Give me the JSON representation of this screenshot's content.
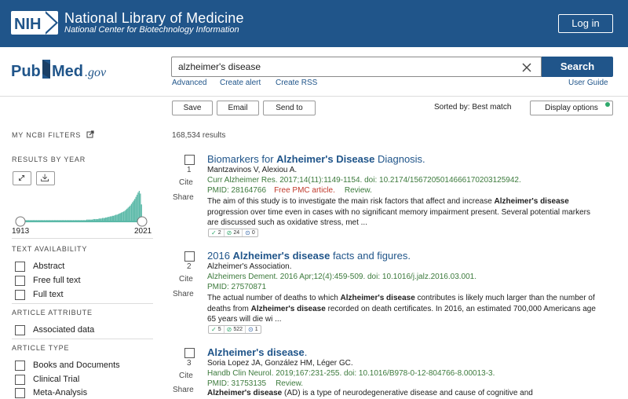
{
  "nih": {
    "logo_text": "NIH",
    "title": "National Library of Medicine",
    "subtitle": "National Center for Biotechnology Information",
    "login": "Log in"
  },
  "search": {
    "logo": "PubMed.gov",
    "query": "alzheimer's disease",
    "button": "Search",
    "links": [
      "Advanced",
      "Create alert",
      "Create RSS"
    ],
    "user_guide": "User Guide"
  },
  "toolbar": {
    "save": "Save",
    "email": "Email",
    "send_to": "Send to",
    "sorted_by": "Sorted by: Best match",
    "display_options": "Display options"
  },
  "sidebar": {
    "filters_head": "MY NCBI FILTERS",
    "by_year_head": "RESULTS BY YEAR",
    "year_start": "1913",
    "year_end": "2021",
    "text_availability_head": "TEXT AVAILABILITY",
    "text_availability": [
      "Abstract",
      "Free full text",
      "Full text"
    ],
    "article_attribute_head": "ARTICLE ATTRIBUTE",
    "article_attribute": [
      "Associated data"
    ],
    "article_type_head": "ARTICLE TYPE",
    "article_type": [
      "Books and Documents",
      "Clinical Trial",
      "Meta-Analysis"
    ]
  },
  "results": {
    "count": "168,534 results",
    "cite_label": "Cite",
    "share_label": "Share",
    "items": [
      {
        "num": "1",
        "title_pre": "Biomarkers for ",
        "title_bold": "Alzheimer's Disease",
        "title_post": " Diagnosis.",
        "authors": "Mantzavinos V, Alexiou A.",
        "citation": "Curr Alzheimer Res. 2017;14(11):1149-1154. doi: 10.2174/1567205014666170203125942.",
        "pmid": "PMID: 28164766",
        "free": "Free PMC article.",
        "review": "Review.",
        "snippet_1": "The aim of this study is to investigate the main risk factors that affect and increase ",
        "snippet_b1": "Alzheimer's",
        "snippet_2": " ",
        "snippet_b2": "disease",
        "snippet_3": " progression over time even in cases with no significant memory impairment present. Several potential markers are discussed such as oxidative stress, met ...",
        "badges": [
          "2",
          "24",
          "0"
        ]
      },
      {
        "num": "2",
        "title_pre": "2016 ",
        "title_bold": "Alzheimer's disease",
        "title_post": " facts and figures.",
        "authors": "Alzheimer's Association.",
        "citation": "Alzheimers Dement. 2016 Apr;12(4):459-509. doi: 10.1016/j.jalz.2016.03.001.",
        "pmid": "PMID: 27570871",
        "snippet_1": "The actual number of deaths to which ",
        "snippet_b1": "Alzheimer's disease",
        "snippet_2": " contributes is likely much larger than the number of deaths from ",
        "snippet_b2": "Alzheimer's disease",
        "snippet_3": " recorded on death certificates. In 2016, an estimated 700,000 Americans age 65 years will die wi ...",
        "badges": [
          "5",
          "522",
          "1"
        ]
      },
      {
        "num": "3",
        "title_pre": "",
        "title_bold": "Alzheimer's disease",
        "title_post": ".",
        "authors": "Soria Lopez JA, González HM, Léger GC.",
        "citation": "Handb Clin Neurol. 2019;167:231-255. doi: 10.1016/B978-0-12-804766-8.00013-3.",
        "pmid": "PMID: 31753135",
        "review": "Review.",
        "snippet_b1": "Alzheimer's disease",
        "snippet_1": " (AD) is a type of neurodegenerative disease and cause of cognitive and"
      }
    ]
  },
  "histogram_heights": [
    1,
    1,
    1,
    1,
    1,
    1,
    1,
    1,
    1,
    1,
    1,
    1,
    1,
    1,
    1,
    1,
    1,
    1,
    1,
    1,
    1,
    1,
    1,
    1,
    1,
    1,
    1,
    1,
    1,
    1,
    1,
    1,
    1,
    1,
    1,
    1,
    1,
    1,
    1,
    1,
    1,
    1,
    1,
    1,
    1,
    1,
    1,
    1,
    1,
    1,
    1,
    1,
    1,
    1,
    1,
    1,
    1,
    1,
    1,
    2,
    2,
    2,
    2,
    2,
    2,
    3,
    3,
    3,
    3,
    3,
    4,
    4,
    4,
    5,
    5,
    5,
    6,
    6,
    7,
    7,
    8,
    8,
    9,
    9,
    10,
    11,
    11,
    12,
    13,
    14,
    15,
    16,
    17,
    18,
    20,
    22,
    24,
    26,
    28,
    31,
    34,
    37,
    40,
    44,
    48,
    52,
    55,
    50,
    30
  ],
  "colors": {
    "brand": "#20558a",
    "review_green": "#3c7a3c",
    "free_red": "#c0392b",
    "histogram": "#5bb9a8"
  }
}
